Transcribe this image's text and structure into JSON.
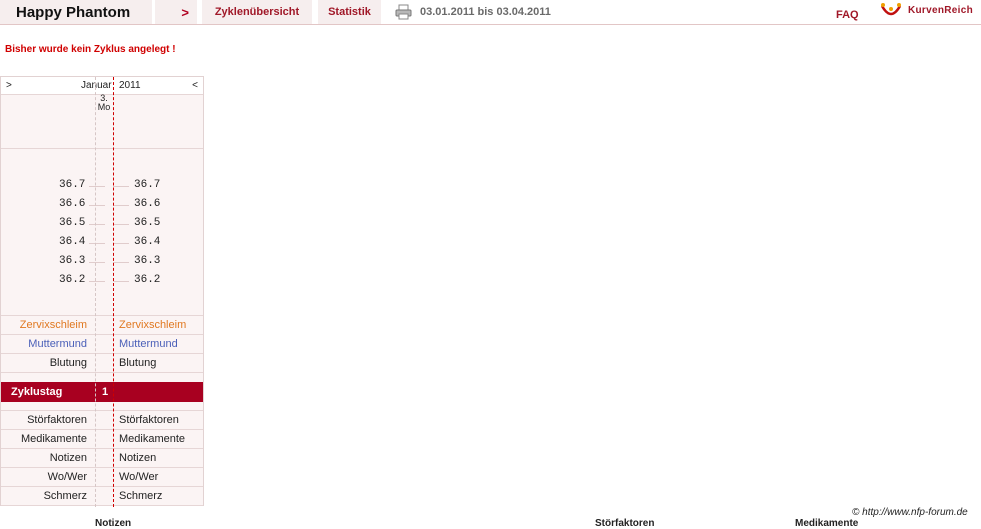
{
  "topbar": {
    "user_name": "Happy Phantom",
    "nav_arrow": ">",
    "tabs": [
      "Zyklenübersicht",
      "Statistik"
    ],
    "date_range": "03.01.2011 bis 03.04.2011",
    "faq": "FAQ",
    "brand": "KurvenReich"
  },
  "warning": "Bisher wurde kein Zyklus angelegt !",
  "chart": {
    "prev": ">",
    "next": "<",
    "month": "Januar",
    "year": "2011",
    "day_num": "3.",
    "day_name": "Mo",
    "temperatures": [
      "36.7",
      "36.6",
      "36.5",
      "36.4",
      "36.3",
      "36.2"
    ],
    "cervix_label": "Zervixschleim",
    "cervix_label_right": "Zervixschleim",
    "muttermund_label": "Muttermund",
    "muttermund_label_right": "Muttermund",
    "blutung_label": "Blutung",
    "blutung_label_right": "Blutung",
    "zyklustag_label": "Zyklustag",
    "zyklustag_value": "1",
    "bottom_rows": [
      {
        "l": "Störfaktoren",
        "r": "Störfaktoren"
      },
      {
        "l": "Medikamente",
        "r": "Medikamente"
      },
      {
        "l": "Notizen",
        "r": "Notizen"
      },
      {
        "l": "Wo/Wer",
        "r": "Wo/Wer"
      },
      {
        "l": "Schmerz",
        "r": "Schmerz"
      }
    ],
    "colors": {
      "cervix": "#e07820",
      "muttermund": "#4a5fb8",
      "zyklustag_bg": "#a80020"
    }
  },
  "footer": {
    "copyright": "© http://www.nfp-forum.de",
    "labels": [
      "Notizen",
      "Störfaktoren",
      "Medikamente"
    ]
  }
}
